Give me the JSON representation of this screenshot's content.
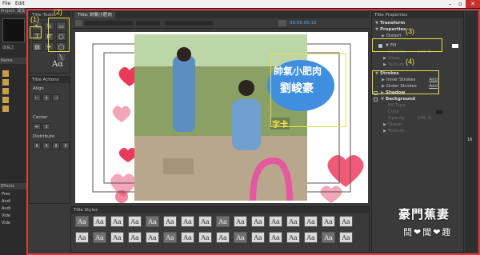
{
  "menu": {
    "file": "File",
    "edit": "Edit"
  },
  "left_strip": {
    "project_label": "Project: 成長",
    "name_label": "Name",
    "effects_label": "Effects",
    "items": [
      "Pres",
      "Audi",
      "Audi",
      "Vide",
      "Vide"
    ],
    "thumb_label": "成長之"
  },
  "title_tools": {
    "header": "Title Tools",
    "type_tool": "T",
    "type_tool_vert": "IT",
    "text_sample": "Aα"
  },
  "title_actions": {
    "header": "Title Actions",
    "align": "Align",
    "center": "Center",
    "distribute": "Distribute"
  },
  "title_designer": {
    "tab": "Title: 帥氣小肥肉",
    "timecode": "00:00:05:13"
  },
  "canvas_text": {
    "title_line1": "帥氣小肥肉",
    "title_line2": "劉峻豪",
    "caption": "字卡"
  },
  "title_styles": {
    "header": "Title Styles",
    "row1": [
      "Aa",
      "Aa",
      "Aa",
      "Aa",
      "Aa",
      "Aa",
      "Aa",
      "Aa",
      "Aa",
      "Aa",
      "Aa",
      "Aa",
      "Aa",
      "Aa",
      "Aa",
      "Aa"
    ],
    "row2": [
      "Aa",
      "Aa",
      "Aa",
      "Aa",
      "Aa",
      "Aa",
      "Aa",
      "Aa",
      "Aa",
      "Aa",
      "Aa",
      "Aa",
      "Aa",
      "Aa",
      "Aa",
      "Aa"
    ]
  },
  "title_properties": {
    "header": "Title Properties",
    "rows": [
      {
        "label": "Transform",
        "bold": true,
        "open": true
      },
      {
        "label": "Properties",
        "bold": true,
        "open": true
      },
      {
        "label": "Distort",
        "bold": false,
        "open": false
      },
      {
        "label": "Fill",
        "bold": false,
        "open": true,
        "checked": true
      },
      {
        "label": "Opacity",
        "value": "100 %",
        "dim": true
      },
      {
        "label": "Gloss",
        "dim": true
      },
      {
        "label": "Texture",
        "dim": true
      },
      {
        "label": "Strokes",
        "bold": true,
        "open": true
      },
      {
        "label": "Inner Strokes",
        "add": "Add"
      },
      {
        "label": "Outer Strokes",
        "add": "Add"
      },
      {
        "label": "Shadow",
        "bold": true,
        "open": false
      },
      {
        "label": "Background",
        "bold": true,
        "open": true
      },
      {
        "label": "Fill Type",
        "dim": true
      },
      {
        "label": "Color",
        "dim": true
      },
      {
        "label": "Opacity",
        "value": "100 %",
        "dim": true
      },
      {
        "label": "Sheen",
        "dim": true
      },
      {
        "label": "Texture",
        "dim": true
      }
    ]
  },
  "annotations": {
    "a1": "(1)",
    "a2": "(2)",
    "a3": "(3)",
    "a4": "(4)"
  },
  "watermark": {
    "line1": "豪門蕉妻",
    "line2": "間❤聞❤趣"
  },
  "colors": {
    "frame": "#e0393e",
    "highlight": "#e8e040",
    "accent_blue": "#3f8ee0"
  }
}
